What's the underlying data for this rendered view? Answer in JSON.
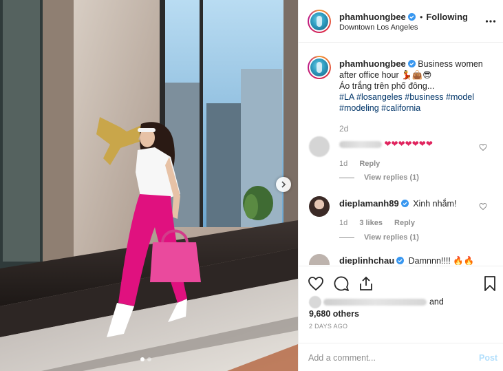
{
  "post": {
    "username": "phamhuongbee",
    "follow_status": "Following",
    "location": "Downtown Los Angeles",
    "caption_text": "Business women after office hour 💃👜😎",
    "caption_line2": "Áo trắng trên phố đông...",
    "hashtags": [
      "#LA",
      "#losangeles",
      "#business",
      "#model",
      "#modeling",
      "#california"
    ],
    "caption_time": "2d"
  },
  "comments": [
    {
      "username_blurred": true,
      "text": "❤❤❤❤❤❤❤",
      "time": "1d",
      "reply_label": "Reply",
      "view_replies": "View replies (1)"
    },
    {
      "username": "dieplamanh89",
      "text": "Xinh nhắm!",
      "time": "1d",
      "likes": "3 likes",
      "reply_label": "Reply",
      "view_replies": "View replies (1)"
    },
    {
      "username": "dieplinhchau",
      "text": "Damnnn!!!! 🔥🔥"
    }
  ],
  "likes": {
    "and_label": "and",
    "others_label": "9,680 others"
  },
  "time_ago": "2 DAYS AGO",
  "add_comment": {
    "placeholder": "Add a comment...",
    "post_label": "Post"
  },
  "colors": {
    "link": "#003569",
    "verified": "#3897f0",
    "post_disabled": "#b2dffc",
    "muted": "#8e8e8e",
    "pants_pink": "#e0117f"
  },
  "carousel": {
    "active_index": 0,
    "count": 2
  }
}
